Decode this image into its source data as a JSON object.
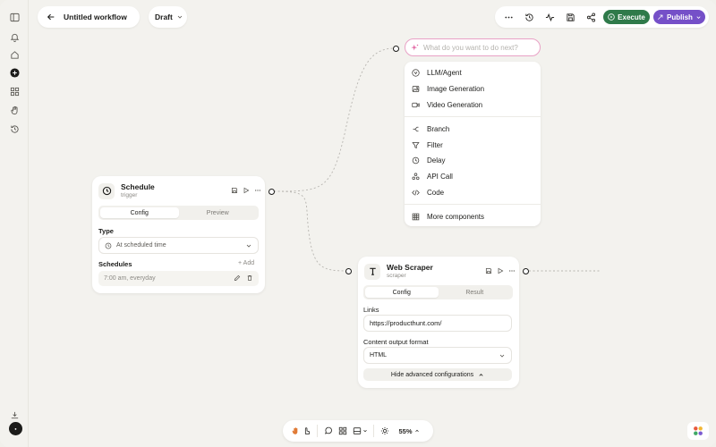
{
  "header": {
    "title": "Untitled workflow",
    "status": "Draft",
    "execute_label": "Execute",
    "publish_label": "Publish"
  },
  "prompt": {
    "placeholder": "What do you want to do next?"
  },
  "menu": {
    "groups": [
      [
        "LLM/Agent",
        "Image Generation",
        "Video Generation"
      ],
      [
        "Branch",
        "Filter",
        "Delay",
        "API Call",
        "Code"
      ],
      [
        "More components"
      ]
    ]
  },
  "schedule_node": {
    "title": "Schedule",
    "subtitle": "trigger",
    "tabs": [
      "Config",
      "Preview"
    ],
    "type_label": "Type",
    "type_value": "At scheduled time",
    "schedules_label": "Schedules",
    "add_label": "+ Add",
    "schedule_item": "7:00 am, everyday"
  },
  "scraper_node": {
    "title": "Web Scraper",
    "subtitle": "scraper",
    "tabs": [
      "Config",
      "Result"
    ],
    "links_label": "Links",
    "links_value": "https://producthunt.com/",
    "format_label": "Content output format",
    "format_value": "HTML",
    "advanced_label": "Hide advanced configurations"
  },
  "bottom_bar": {
    "zoom": "55%"
  },
  "colors": {
    "execute": "#2f7a4a",
    "publish": "#7550c8",
    "prompt_border": "#e9a2c6",
    "canvas": "#f3f2ee"
  }
}
